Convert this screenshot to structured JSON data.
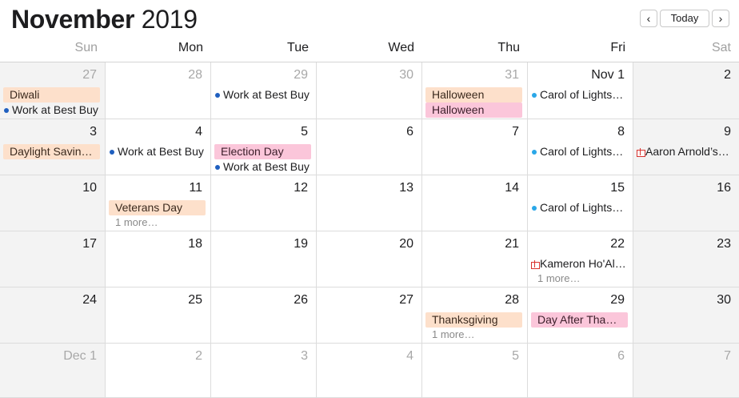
{
  "header": {
    "month": "November",
    "year": "2019",
    "prev_label": "‹",
    "today_label": "Today",
    "next_label": "›"
  },
  "weekdays": [
    "Sun",
    "Mon",
    "Tue",
    "Wed",
    "Thu",
    "Fri",
    "Sat"
  ],
  "colors": {
    "holiday": "#fde0cb",
    "special": "#fbc6da",
    "work_dot": "#1f5fbf",
    "lights_dot": "#2aa7e8",
    "birthday_icon": "#d8332f"
  },
  "weeks": [
    [
      {
        "day": "27",
        "muted": true,
        "events": [
          {
            "kind": "allday",
            "color": "orange",
            "title": "Diwali"
          },
          {
            "kind": "timed",
            "dot": "navy",
            "title": "Work at Best Buy"
          }
        ]
      },
      {
        "day": "28",
        "muted": true,
        "events": []
      },
      {
        "day": "29",
        "muted": true,
        "events": [
          {
            "kind": "timed",
            "dot": "navy",
            "title": "Work at Best Buy"
          }
        ]
      },
      {
        "day": "30",
        "muted": true,
        "events": []
      },
      {
        "day": "31",
        "muted": true,
        "events": [
          {
            "kind": "allday",
            "color": "orange",
            "title": "Halloween"
          },
          {
            "kind": "allday",
            "color": "pink",
            "title": "Halloween"
          }
        ]
      },
      {
        "day": "Nov 1",
        "muted": false,
        "events": [
          {
            "kind": "timed",
            "dot": "sky",
            "title": "Carol of Lights…"
          }
        ]
      },
      {
        "day": "2",
        "muted": false,
        "events": []
      }
    ],
    [
      {
        "day": "3",
        "muted": false,
        "events": [
          {
            "kind": "allday",
            "color": "orange",
            "title": "Daylight Savin…"
          }
        ]
      },
      {
        "day": "4",
        "muted": false,
        "events": [
          {
            "kind": "timed",
            "dot": "navy",
            "title": "Work at Best Buy"
          }
        ]
      },
      {
        "day": "5",
        "muted": false,
        "events": [
          {
            "kind": "allday",
            "color": "pink",
            "title": "Election Day"
          },
          {
            "kind": "timed",
            "dot": "navy",
            "title": "Work at Best Buy"
          }
        ]
      },
      {
        "day": "6",
        "muted": false,
        "events": []
      },
      {
        "day": "7",
        "muted": false,
        "events": []
      },
      {
        "day": "8",
        "muted": false,
        "events": [
          {
            "kind": "timed",
            "dot": "sky",
            "title": "Carol of Lights…"
          }
        ]
      },
      {
        "day": "9",
        "muted": false,
        "events": [
          {
            "kind": "birthday",
            "title": "Aaron Arnold’s…"
          }
        ]
      }
    ],
    [
      {
        "day": "10",
        "muted": false,
        "events": []
      },
      {
        "day": "11",
        "muted": false,
        "events": [
          {
            "kind": "allday",
            "color": "orange",
            "title": "Veterans Day"
          }
        ],
        "more": "1 more…"
      },
      {
        "day": "12",
        "muted": false,
        "events": []
      },
      {
        "day": "13",
        "muted": false,
        "events": []
      },
      {
        "day": "14",
        "muted": false,
        "events": []
      },
      {
        "day": "15",
        "muted": false,
        "events": [
          {
            "kind": "timed",
            "dot": "sky",
            "title": "Carol of Lights…"
          }
        ]
      },
      {
        "day": "16",
        "muted": false,
        "events": []
      }
    ],
    [
      {
        "day": "17",
        "muted": false,
        "events": []
      },
      {
        "day": "18",
        "muted": false,
        "events": []
      },
      {
        "day": "19",
        "muted": false,
        "events": []
      },
      {
        "day": "20",
        "muted": false,
        "events": []
      },
      {
        "day": "21",
        "muted": false,
        "events": []
      },
      {
        "day": "22",
        "muted": false,
        "events": [
          {
            "kind": "birthday",
            "title": "Kameron Ho'Al…"
          }
        ],
        "more": "1 more…"
      },
      {
        "day": "23",
        "muted": false,
        "events": []
      }
    ],
    [
      {
        "day": "24",
        "muted": false,
        "events": []
      },
      {
        "day": "25",
        "muted": false,
        "events": []
      },
      {
        "day": "26",
        "muted": false,
        "events": []
      },
      {
        "day": "27",
        "muted": false,
        "events": []
      },
      {
        "day": "28",
        "muted": false,
        "events": [
          {
            "kind": "allday",
            "color": "orange",
            "title": "Thanksgiving"
          }
        ],
        "more": "1 more…"
      },
      {
        "day": "29",
        "muted": false,
        "events": [
          {
            "kind": "allday",
            "color": "pink",
            "title": "Day After Tha…"
          }
        ]
      },
      {
        "day": "30",
        "muted": false,
        "events": []
      }
    ],
    [
      {
        "day": "Dec 1",
        "muted": true,
        "events": []
      },
      {
        "day": "2",
        "muted": true,
        "events": []
      },
      {
        "day": "3",
        "muted": true,
        "events": []
      },
      {
        "day": "4",
        "muted": true,
        "events": []
      },
      {
        "day": "5",
        "muted": true,
        "events": []
      },
      {
        "day": "6",
        "muted": true,
        "events": []
      },
      {
        "day": "7",
        "muted": true,
        "events": []
      }
    ]
  ]
}
